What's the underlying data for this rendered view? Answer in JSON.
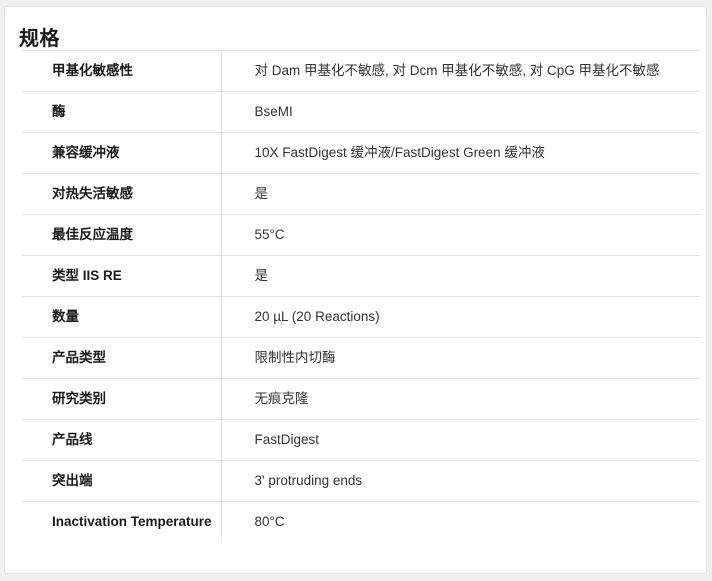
{
  "section": {
    "title": "规格"
  },
  "specs": [
    {
      "label": "甲基化敏感性",
      "value": "对 Dam 甲基化不敏感, 对 Dcm 甲基化不敏感, 对 CpG 甲基化不敏感"
    },
    {
      "label": "酶",
      "value": "BseMI"
    },
    {
      "label": "兼容缓冲液",
      "value": "10X FastDigest 缓冲液/FastDigest Green 缓冲液"
    },
    {
      "label": "对热失活敏感",
      "value": "是"
    },
    {
      "label": "最佳反应温度",
      "value": "55°C"
    },
    {
      "label": "类型 IIS RE",
      "value": "是"
    },
    {
      "label": "数量",
      "value": "20 µL (20 Reactions)"
    },
    {
      "label": "产品类型",
      "value": "限制性内切酶"
    },
    {
      "label": "研究类别",
      "value": "无痕克隆"
    },
    {
      "label": "产品线",
      "value": "FastDigest"
    },
    {
      "label": "突出端",
      "value": "3' protruding ends"
    },
    {
      "label": "Inactivation Temperature",
      "value": "80°C"
    }
  ]
}
